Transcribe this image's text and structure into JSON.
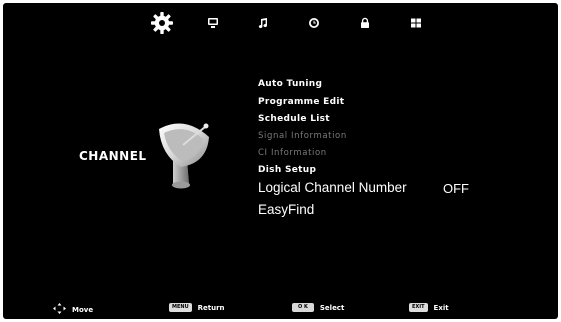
{
  "tabs": [
    {
      "icon": "gear-icon",
      "active": true
    },
    {
      "icon": "monitor-icon",
      "active": false
    },
    {
      "icon": "music-note-icon",
      "active": false
    },
    {
      "icon": "clock-icon",
      "active": false
    },
    {
      "icon": "lock-icon",
      "active": false
    },
    {
      "icon": "grid-icon",
      "active": false
    }
  ],
  "category": {
    "label": "CHANNEL",
    "icon": "satellite-dish-icon"
  },
  "menu": {
    "items": [
      {
        "label": "Auto Tuning",
        "enabled": true
      },
      {
        "label": "Programme Edit",
        "enabled": true
      },
      {
        "label": "Schedule List",
        "enabled": true
      },
      {
        "label": "Signal Information",
        "enabled": false
      },
      {
        "label": "CI Information",
        "enabled": false
      },
      {
        "label": "Dish Setup",
        "enabled": true
      },
      {
        "label": "Logical Channel Number",
        "enabled": true,
        "value": "OFF"
      },
      {
        "label": "EasyFind",
        "enabled": true
      }
    ]
  },
  "footer": {
    "move": {
      "icon": "dpad-icon",
      "label": "Move"
    },
    "return": {
      "key": "MENU",
      "label": "Return"
    },
    "select": {
      "key": "O K",
      "label": "Select"
    },
    "exit": {
      "key": "EXIT",
      "label": "Exit"
    }
  },
  "colors": {
    "background": "#000000",
    "text": "#ffffff",
    "disabled_text": "#7a7a7a"
  }
}
